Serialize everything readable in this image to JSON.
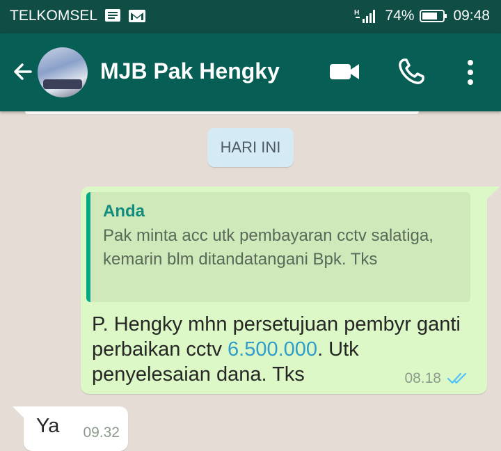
{
  "status_bar": {
    "carrier": "TELKOMSEL",
    "signal_label": "H",
    "battery": "74%",
    "time": "09:48"
  },
  "header": {
    "contact_name": "MJB Pak Hengky"
  },
  "chat": {
    "date_chip": "HARI INI",
    "outgoing": {
      "quote_author": "Anda",
      "quote_text": "Pak minta acc utk pembayaran cctv salatiga, kemarin blm ditandatangani Bpk. Tks",
      "text_before": "P. Hengky mhn persetujuan pembyr ganti perbaikan cctv ",
      "amount": "6.500.000",
      "text_after": ". Utk penyelesaian dana. Tks",
      "time": "08.18",
      "status": "delivered"
    },
    "incoming": {
      "text": "Ya",
      "time": "09.32"
    }
  },
  "colors": {
    "status_bar": "#0f4d45",
    "app_bar": "#075e54",
    "chat_bg": "#e5ddd5",
    "outgoing_bubble": "#dcf8c6",
    "quote_accent": "#06a884",
    "link_amount": "#2f9cc9",
    "tick": "#4fc3f7"
  }
}
